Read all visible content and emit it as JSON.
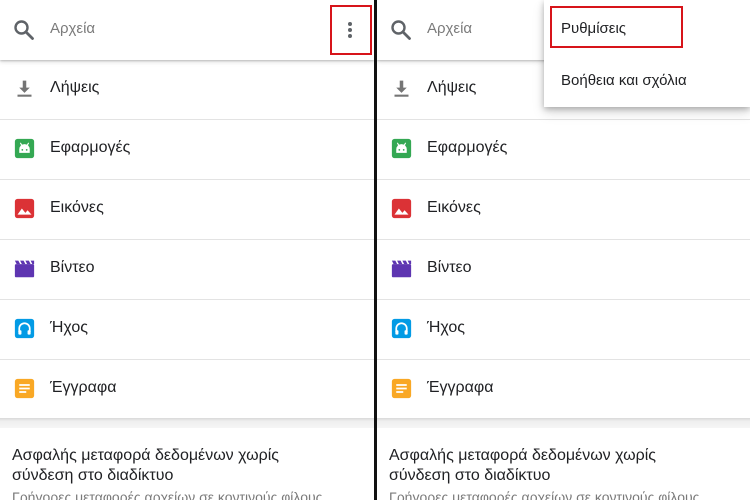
{
  "search": {
    "placeholder": "Αρχεία"
  },
  "categories": [
    {
      "label": "Λήψεις",
      "icon": "download-icon",
      "color": "#757575"
    },
    {
      "label": "Εφαρμογές",
      "icon": "android-icon",
      "color": "#34a853"
    },
    {
      "label": "Εικόνες",
      "icon": "image-icon",
      "color": "#db3236"
    },
    {
      "label": "Βίντεο",
      "icon": "video-icon",
      "color": "#5e35b1"
    },
    {
      "label": "Ήχος",
      "icon": "headphones-icon",
      "color": "#039be5"
    },
    {
      "label": "Έγγραφα",
      "icon": "document-icon",
      "color": "#f9a825"
    }
  ],
  "promo": {
    "title": "Ασφαλής μεταφορά δεδομένων χωρίς σύνδεση στο διαδίκτυο",
    "subtitle": "Γρήγορες μεταφορές αρχείων σε κοντινούς φίλους"
  },
  "menu": {
    "items": [
      {
        "label": "Ρυθμίσεις",
        "highlighted": true
      },
      {
        "label": "Βοήθεια και σχόλια",
        "highlighted": false
      }
    ]
  },
  "colors": {
    "highlight": "#d7141a",
    "icon_gray": "#5f6368"
  }
}
